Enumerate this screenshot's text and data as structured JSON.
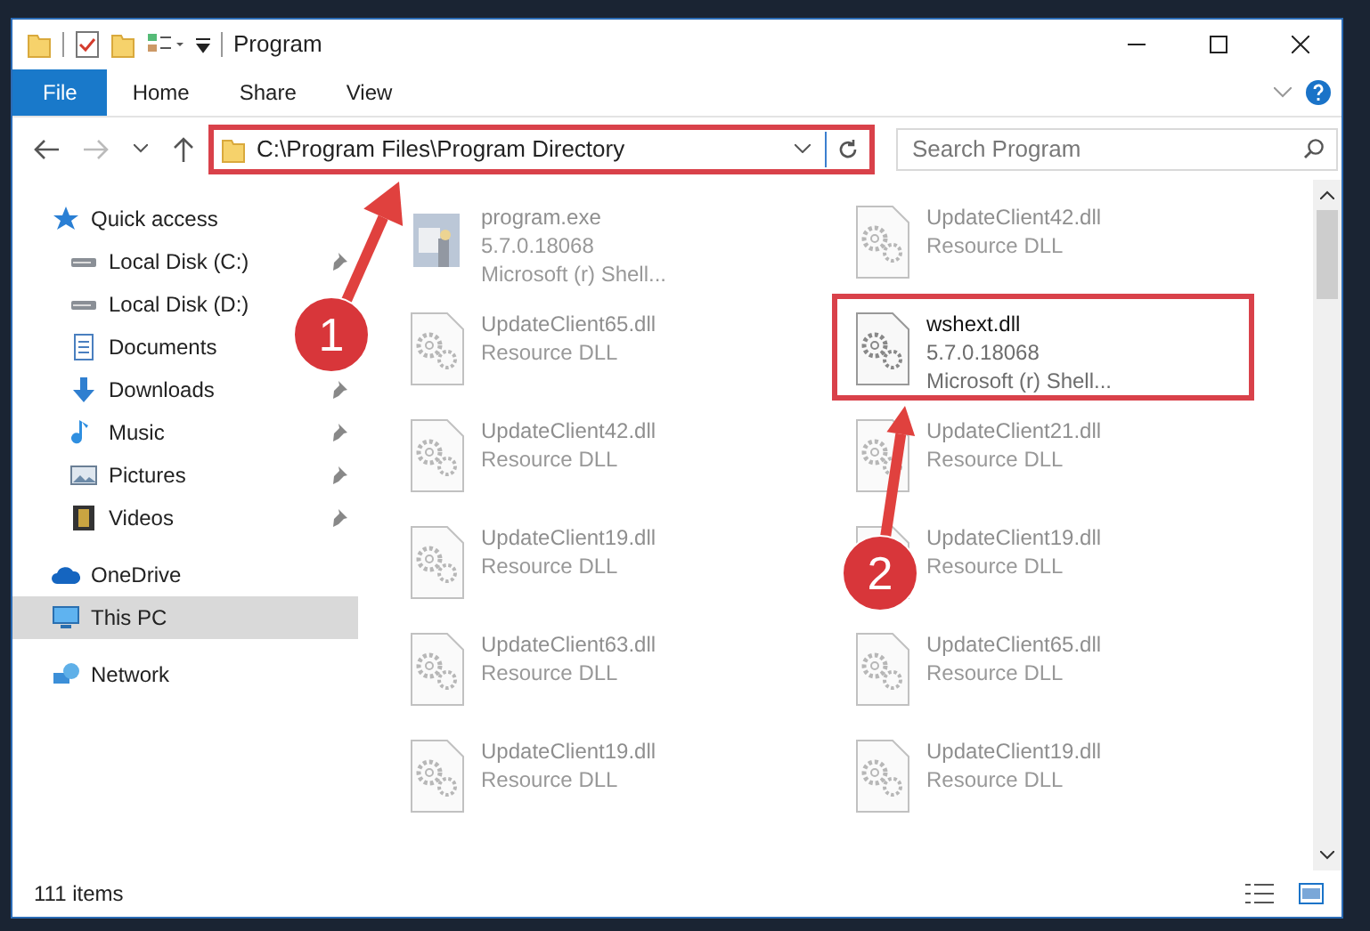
{
  "window": {
    "title": "Program"
  },
  "ribbon_tabs": [
    {
      "label": "File",
      "selected": true
    },
    {
      "label": "Home",
      "selected": false
    },
    {
      "label": "Share",
      "selected": false
    },
    {
      "label": "View",
      "selected": false
    }
  ],
  "address_bar": {
    "path": "C:\\Program Files\\Program Directory",
    "highlighted": true
  },
  "search": {
    "placeholder": "Search Program"
  },
  "sidebar": {
    "items": [
      {
        "label": "Quick access",
        "kind": "star",
        "selected": false,
        "children": [
          {
            "label": "Local Disk (C:)",
            "kind": "disk",
            "pinned": true,
            "selected": false
          },
          {
            "label": "Local Disk (D:)",
            "kind": "disk",
            "pinned": false,
            "selected": false
          },
          {
            "label": "Documents",
            "kind": "documents",
            "pinned": false,
            "selected": false
          },
          {
            "label": "Downloads",
            "kind": "downloads",
            "pinned": true,
            "selected": false
          },
          {
            "label": "Music",
            "kind": "music",
            "pinned": true,
            "selected": false
          },
          {
            "label": "Pictures",
            "kind": "pictures",
            "pinned": true,
            "selected": false
          },
          {
            "label": "Videos",
            "kind": "videos",
            "pinned": true,
            "selected": false
          }
        ]
      },
      {
        "label": "OneDrive",
        "kind": "cloud",
        "selected": false
      },
      {
        "label": "This PC",
        "kind": "pc",
        "selected": true
      },
      {
        "label": "Network",
        "kind": "network",
        "selected": false
      }
    ]
  },
  "files": [
    {
      "kind": "exe",
      "name": "program.exe",
      "details": [
        "5.7.0.18068",
        "Microsoft (r) Shell..."
      ],
      "blurred": true,
      "highlighted": false
    },
    {
      "kind": "dll",
      "name": "UpdateClient42.dll",
      "details": [
        "Resource DLL"
      ],
      "blurred": true,
      "highlighted": false
    },
    {
      "kind": "dll",
      "name": "UpdateClient65.dll",
      "details": [
        "Resource DLL"
      ],
      "blurred": true,
      "highlighted": false
    },
    {
      "kind": "dll",
      "name": "wshext.dll",
      "details": [
        "5.7.0.18068",
        "Microsoft (r) Shell..."
      ],
      "blurred": false,
      "highlighted": true
    },
    {
      "kind": "dll",
      "name": "UpdateClient42.dll",
      "details": [
        "Resource DLL"
      ],
      "blurred": true,
      "highlighted": false
    },
    {
      "kind": "dll",
      "name": "UpdateClient21.dll",
      "details": [
        "Resource DLL"
      ],
      "blurred": true,
      "highlighted": false
    },
    {
      "kind": "dll",
      "name": "UpdateClient19.dll",
      "details": [
        "Resource DLL"
      ],
      "blurred": true,
      "highlighted": false
    },
    {
      "kind": "dll",
      "name": "UpdateClient19.dll",
      "details": [
        "Resource DLL"
      ],
      "blurred": true,
      "highlighted": false
    },
    {
      "kind": "dll",
      "name": "UpdateClient63.dll",
      "details": [
        "Resource DLL"
      ],
      "blurred": true,
      "highlighted": false
    },
    {
      "kind": "dll",
      "name": "UpdateClient65.dll",
      "details": [
        "Resource DLL"
      ],
      "blurred": true,
      "highlighted": false
    },
    {
      "kind": "dll",
      "name": "UpdateClient19.dll",
      "details": [
        "Resource DLL"
      ],
      "blurred": true,
      "highlighted": false
    },
    {
      "kind": "dll",
      "name": "UpdateClient19.dll",
      "details": [
        "Resource DLL"
      ],
      "blurred": true,
      "highlighted": false
    }
  ],
  "status_bar": {
    "item_count": "111 items"
  },
  "annotations": [
    {
      "label": "1"
    },
    {
      "label": "2"
    }
  ]
}
